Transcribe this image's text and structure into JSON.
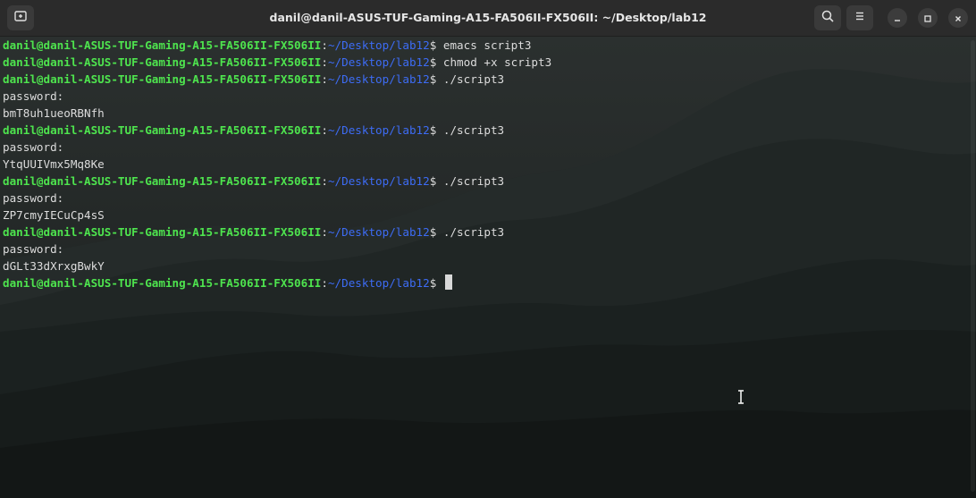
{
  "window": {
    "title": "danil@danil-ASUS-TUF-Gaming-A15-FA506II-FX506II: ~/Desktop/lab12",
    "icons": {
      "new_tab": "new-tab-icon",
      "search": "search-icon",
      "menu": "hamburger-menu-icon",
      "minimize": "minimize-icon",
      "maximize": "maximize-icon",
      "close": "close-icon"
    }
  },
  "prompt": {
    "user": "danil@danil-ASUS-TUF-Gaming-A15-FA506II-FX506II",
    "colon": ":",
    "path": "~/Desktop/lab12",
    "dollar": "$"
  },
  "terminal": {
    "lines": [
      {
        "type": "prompt",
        "cmd": " emacs script3"
      },
      {
        "type": "prompt",
        "cmd": " chmod +x script3"
      },
      {
        "type": "prompt",
        "cmd": " ./script3"
      },
      {
        "type": "output",
        "text": "password:"
      },
      {
        "type": "output",
        "text": "bmT8uh1ueoRBNfh"
      },
      {
        "type": "prompt",
        "cmd": " ./script3"
      },
      {
        "type": "output",
        "text": "password:"
      },
      {
        "type": "output",
        "text": "YtqUUIVmx5Mq8Ke"
      },
      {
        "type": "prompt",
        "cmd": " ./script3"
      },
      {
        "type": "output",
        "text": "password:"
      },
      {
        "type": "output",
        "text": "ZP7cmyIECuCp4sS"
      },
      {
        "type": "prompt",
        "cmd": " ./script3"
      },
      {
        "type": "output",
        "text": "password:"
      },
      {
        "type": "output",
        "text": "dGLt33dXrxgBwkY"
      },
      {
        "type": "prompt",
        "cmd": " ",
        "cursor": true
      }
    ]
  },
  "colors": {
    "user_host": "#4ee44e",
    "path": "#3d6cf5",
    "text": "#dcdcdc",
    "titlebar": "#2b2b2b"
  }
}
